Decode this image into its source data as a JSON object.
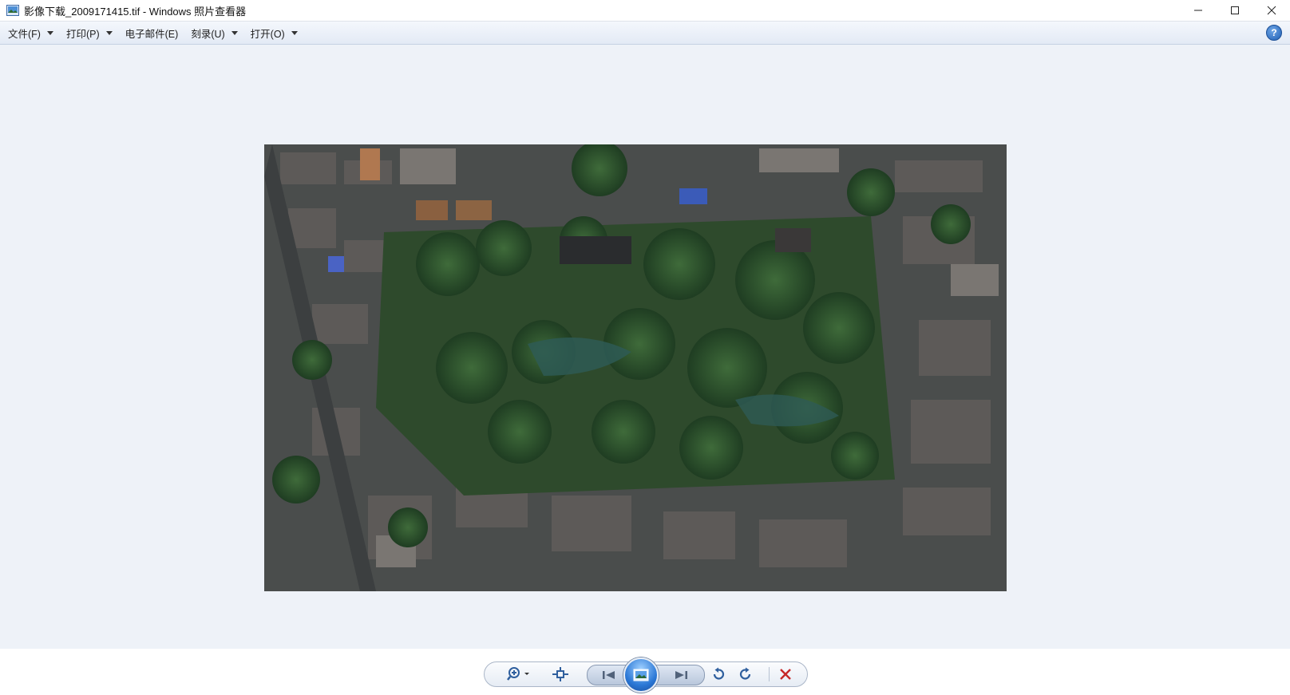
{
  "window": {
    "title": "影像下载_2009171415.tif - Windows 照片查看器",
    "icon": "photo-viewer-icon",
    "controls": [
      "minimize-icon",
      "maximize-icon",
      "close-icon"
    ]
  },
  "menubar": {
    "items": [
      {
        "label": "文件(F)",
        "has_dropdown": true
      },
      {
        "label": "打印(P)",
        "has_dropdown": true
      },
      {
        "label": "电子邮件(E)",
        "has_dropdown": false
      },
      {
        "label": "刻录(U)",
        "has_dropdown": true
      },
      {
        "label": "打开(O)",
        "has_dropdown": true
      }
    ],
    "help_label": "?"
  },
  "viewer": {
    "image_description_icon": "satellite-aerial-image"
  },
  "toolbar": {
    "buttons": [
      "zoom-icon",
      "actual-size-icon",
      "previous-icon",
      "slideshow-icon",
      "next-icon",
      "rotate-counterclockwise-icon",
      "rotate-clockwise-icon",
      "delete-icon"
    ]
  },
  "colors": {
    "background": "#eef2f8",
    "accent": "#2b78d6",
    "delete": "#c62828"
  }
}
